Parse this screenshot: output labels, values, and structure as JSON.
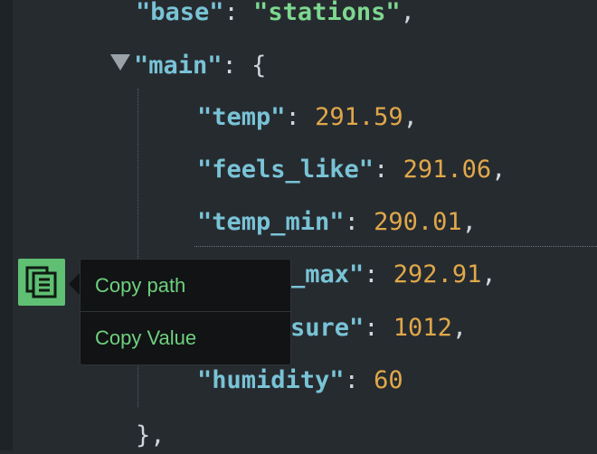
{
  "json": {
    "base_key": "\"base\"",
    "base_value": "\"stations\"",
    "main_key": "\"main\"",
    "open_brace": "{",
    "colon_sep": ": ",
    "comma": ",",
    "fields": [
      {
        "key": "\"temp\"",
        "value": "291.59",
        "comma": ","
      },
      {
        "key": "\"feels_like\"",
        "value": "291.06",
        "comma": ","
      },
      {
        "key": "\"temp_min\"",
        "value": "290.01",
        "comma": ","
      },
      {
        "key": "_max\"",
        "value": "292.91",
        "comma": ","
      },
      {
        "key": "sure\"",
        "value": "1012",
        "comma": ","
      },
      {
        "key": "\"humidity\"",
        "value": "60",
        "comma": ""
      }
    ],
    "close_brace": "},"
  },
  "context_menu": {
    "items": [
      {
        "label": "Copy path"
      },
      {
        "label": "Copy Value"
      }
    ]
  },
  "colors": {
    "background": "#262b30",
    "key": "#79c3d6",
    "string": "#7ed88f",
    "number": "#e0a84a",
    "menu_text": "#6fd07e",
    "copy_button": "#5fbf73"
  },
  "icons": {
    "toggle": "collapse-triangle-icon",
    "copy": "copy-icon"
  }
}
